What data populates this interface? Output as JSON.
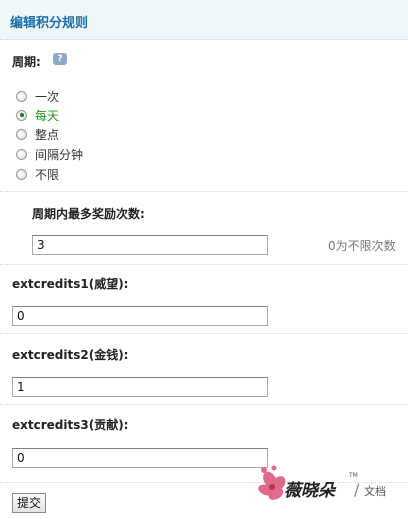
{
  "header": {
    "title": "编辑积分规则"
  },
  "period": {
    "label": "周期:",
    "help_icon": "help-bubble-icon",
    "options": [
      "一次",
      "每天",
      "整点",
      "间隔分钟",
      "不限"
    ],
    "selected": "每天"
  },
  "max_rewards": {
    "label": "周期内最多奖励次数:",
    "value": "3",
    "hint": "0为不限次数"
  },
  "credits": [
    {
      "label": "extcredits1(威望):",
      "value": "0"
    },
    {
      "label": "extcredits2(金钱):",
      "value": "1"
    },
    {
      "label": "extcredits3(贡献):",
      "value": "0"
    }
  ],
  "submit_label": "提交",
  "watermark": {
    "brand": "薇晓朵",
    "tm": "TM",
    "suffix": "文档"
  },
  "colors": {
    "title": "#1a6ea8",
    "selected": "#1f9a1f",
    "header_bg": "#f0f7fb"
  }
}
